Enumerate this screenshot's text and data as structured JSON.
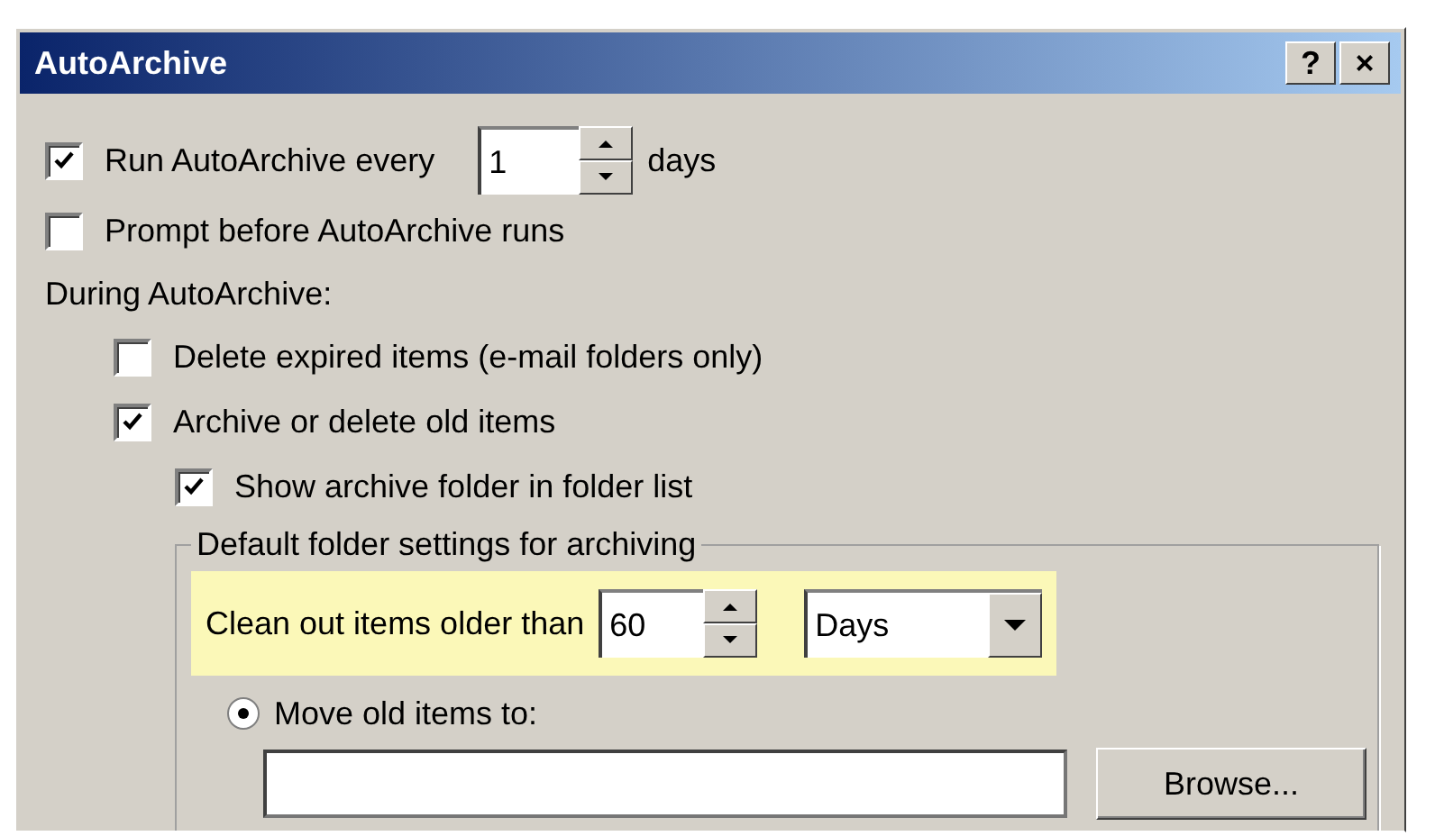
{
  "window": {
    "title": "AutoArchive",
    "buttons": [
      "?",
      "×"
    ]
  },
  "run_every": {
    "label": "Run AutoArchive every",
    "checked": true,
    "value": "1",
    "unit": "days"
  },
  "prompt": {
    "label": "Prompt before AutoArchive runs",
    "checked": false
  },
  "during_label": "During AutoArchive:",
  "options": [
    {
      "label": "Delete expired items (e-mail folders only)",
      "checked": false
    },
    {
      "label": "Archive or delete old items",
      "checked": true,
      "children": [
        {
          "label": "Show archive folder in folder list",
          "checked": true
        }
      ]
    }
  ],
  "group": {
    "title": "Default folder settings for archiving",
    "clean_out": {
      "label": "Clean out items older than",
      "value": "60",
      "unit": "Days",
      "highlighted": true
    },
    "move": {
      "label": "Move old items to:",
      "selected": true,
      "button": "Browse..."
    }
  }
}
